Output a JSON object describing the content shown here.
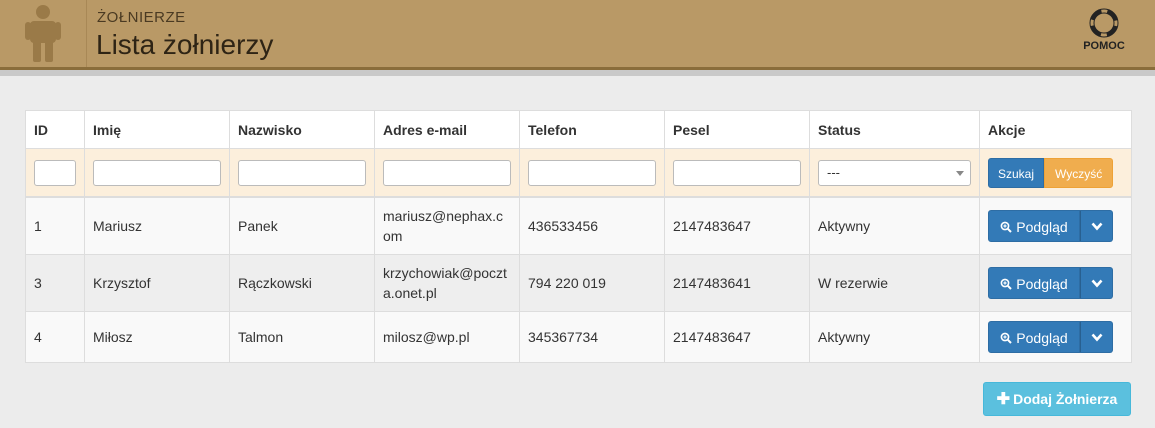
{
  "header": {
    "subtitle": "ŻOŁNIERZE",
    "title": "Lista żołnierzy",
    "help_label": "POMOC",
    "brand_color": "#b99966"
  },
  "table": {
    "columns": [
      "ID",
      "Imię",
      "Nazwisko",
      "Adres e-mail",
      "Telefon",
      "Pesel",
      "Status",
      "Akcje"
    ],
    "filters": {
      "status_selected": "---",
      "search_label": "Szukaj",
      "clear_label": "Wyczyść"
    },
    "rows": [
      {
        "id": "1",
        "first": "Mariusz",
        "last": "Panek",
        "email_1": "mariusz@nephax.c",
        "email_2": "om",
        "phone": "436533456",
        "pesel": "2147483647",
        "status": "Aktywny"
      },
      {
        "id": "3",
        "first": "Krzysztof",
        "last": "Rączkowski",
        "email_1": "krzychowiak@poczt",
        "email_2": "a.onet.pl",
        "phone": "794 220 019",
        "pesel": "2147483641",
        "status": "W rezerwie"
      },
      {
        "id": "4",
        "first": "Miłosz",
        "last": "Talmon",
        "email_1": "milosz@wp.pl",
        "email_2": "",
        "phone": "345367734",
        "pesel": "2147483647",
        "status": "Aktywny"
      }
    ],
    "view_label": "Podgląd"
  },
  "add_button_label": "Dodaj Żołnierza",
  "colors": {
    "primary": "#337ab7",
    "warning": "#f0ad4e",
    "info": "#5bc0de",
    "filter_bg": "#fcefdc"
  }
}
